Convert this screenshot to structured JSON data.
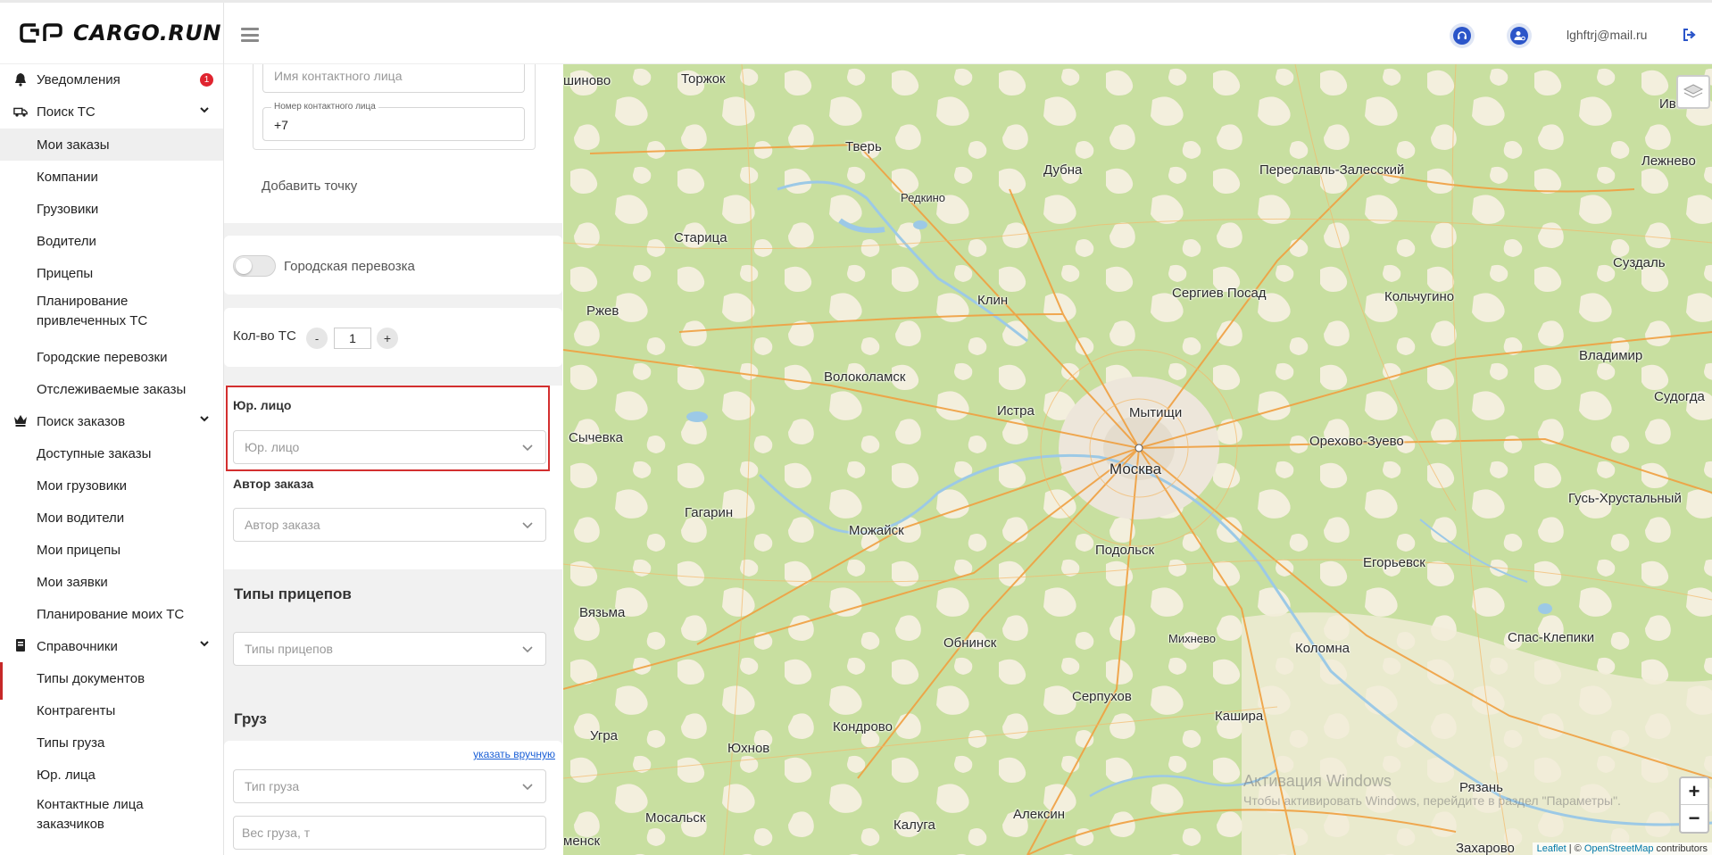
{
  "header": {
    "logo_text": "CARGO.RUN",
    "user_email": "lghftrj@mail.ru",
    "icons": [
      "support-icon",
      "user-settings-icon",
      "logout-icon",
      "menu-icon"
    ]
  },
  "sidebar": {
    "notifications": {
      "label": "Уведомления",
      "badge": "1"
    },
    "sections": [
      {
        "label": "Поиск ТС",
        "items": [
          "Мои заказы",
          "Компании",
          "Грузовики",
          "Водители",
          "Прицепы",
          "Планирование привлеченных ТС",
          "Городские перевозки",
          "Отслеживаемые заказы"
        ]
      },
      {
        "label": "Поиск заказов",
        "items": [
          "Доступные заказы",
          "Мои грузовики",
          "Мои водители",
          "Мои прицепы",
          "Мои заявки",
          "Планирование моих ТС"
        ]
      },
      {
        "label": "Справочники",
        "items": [
          "Типы документов",
          "Контрагенты",
          "Типы груза",
          "Юр. лица",
          "Контактные лица заказчиков"
        ]
      }
    ],
    "active_item": "Мои заказы"
  },
  "form": {
    "contact_name_placeholder": "Имя контактного лица",
    "contact_phone_label": "Номер контактного лица",
    "contact_phone_value": "+7",
    "add_point": "Добавить точку",
    "city_transport_label": "Городская перевозка",
    "vehicle_count_label": "Кол-во ТС",
    "vehicle_count_minus": "-",
    "vehicle_count_value": "1",
    "vehicle_count_plus": "+",
    "legal_entity_title": "Юр. лицо",
    "legal_entity_placeholder": "Юр. лицо",
    "author_title": "Автор заказа",
    "author_placeholder": "Автор заказа",
    "trailer_types_title": "Типы прицепов",
    "trailer_types_placeholder": "Типы прицепов",
    "cargo_title": "Груз",
    "manual_link": "указать вручную",
    "cargo_type_placeholder": "Тип груза",
    "cargo_weight_placeholder": "Вес груза, т"
  },
  "map": {
    "cities": [
      "шиново",
      "Торжок",
      "Иванов",
      "Тверь",
      "Дубна",
      "Переславль-Залесский",
      "Лежнево",
      "Редкино",
      "Старица",
      "Суздаль",
      "Клин",
      "Сергиев Посад",
      "Кольчугино",
      "Ржев",
      "Владимир",
      "Волоколамск",
      "Истра",
      "Мытищи",
      "Судогда",
      "Сычевка",
      "Орехово-Зуево",
      "Москва",
      "Гагарин",
      "Можайск",
      "Гусь-Хрустальный",
      "Подольск",
      "Егорьевск",
      "Вязьма",
      "Обнинск",
      "Михнево",
      "Коломна",
      "Спас-Клепики",
      "Серпухов",
      "Кашира",
      "Угра",
      "Кондрово",
      "Юхнов",
      "Рязань",
      "Мосальск",
      "Калуга",
      "Алексин",
      "менск",
      "Захарово"
    ],
    "zoom_in": "+",
    "zoom_out": "−",
    "attribution_leaflet": "Leaflet",
    "attribution_mid": " | © ",
    "attribution_osm": "OpenStreetMap",
    "attribution_end": " contributors",
    "watermark_title": "Активация Windows",
    "watermark_sub": "Чтобы активировать Windows, перейдите в раздел \"Параметры\"."
  }
}
